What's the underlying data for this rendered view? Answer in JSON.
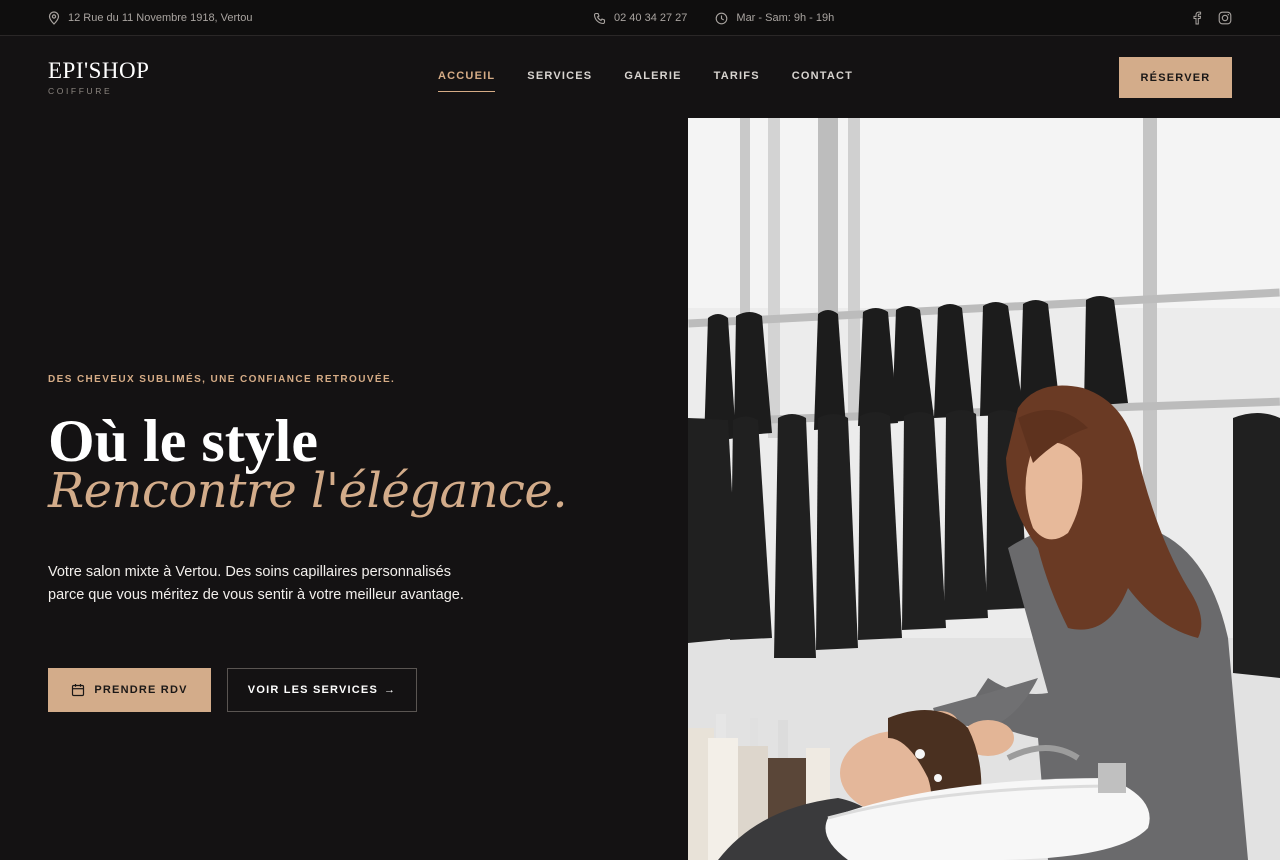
{
  "topbar": {
    "address": "12 Rue du 11 Novembre 1918, Vertou",
    "phone": "02 40 34 27 27",
    "hours": "Mar - Sam: 9h - 19h",
    "icons": [
      "location-pin-icon",
      "phone-icon",
      "clock-icon",
      "facebook-icon",
      "instagram-icon"
    ]
  },
  "header": {
    "logo": {
      "name": "EPI'SHOP",
      "tagline": "COIFFURE"
    },
    "nav": [
      {
        "label": "ACCUEIL",
        "active": true
      },
      {
        "label": "SERVICES",
        "active": false
      },
      {
        "label": "GALERIE",
        "active": false
      },
      {
        "label": "TARIFS",
        "active": false
      },
      {
        "label": "CONTACT",
        "active": false
      }
    ],
    "cta_label": "RÉSERVER"
  },
  "hero": {
    "eyebrow": "DES CHEVEUX SUBLIMÉS, UNE CONFIANCE RETROUVÉE.",
    "title_line1": "Où le style",
    "title_line2": "Rencontre l'élégance.",
    "lead": "Votre salon mixte à Vertou. Des soins capillaires personnalisés parce que vous méritez de vous sentir à votre meilleur avantage.",
    "primary_button": {
      "label": "PRENDRE RDV",
      "icon": "calendar-icon"
    },
    "secondary_button": {
      "label": "VOIR LES SERVICES",
      "arrow": "→"
    }
  },
  "colors": {
    "background": "#141213",
    "topbar": "#0f0e0e",
    "accent": "#d3ac8a",
    "accent_text": "#d6ac86",
    "text": "#ffffff",
    "muted": "#a9a4a0"
  }
}
